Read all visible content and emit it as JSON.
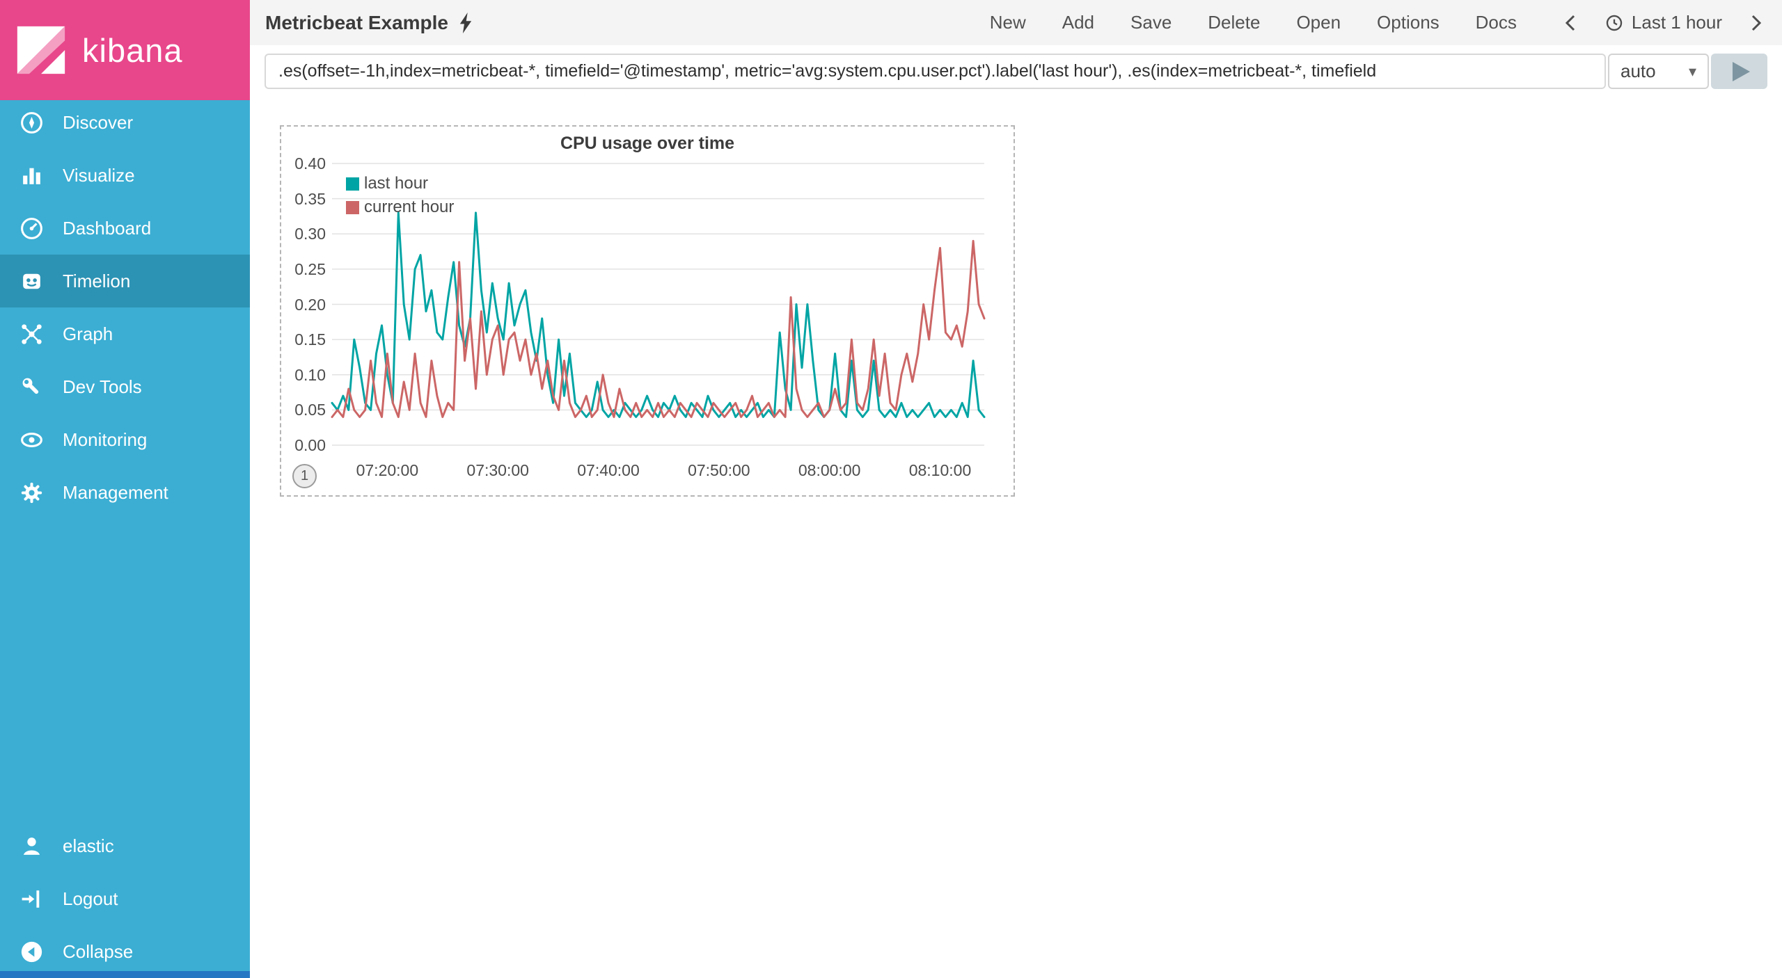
{
  "sidebar": {
    "logo_text": "kibana",
    "items": [
      {
        "label": "Discover",
        "icon": "compass-icon"
      },
      {
        "label": "Visualize",
        "icon": "bar-chart-icon"
      },
      {
        "label": "Dashboard",
        "icon": "gauge-icon"
      },
      {
        "label": "Timelion",
        "icon": "timelion-icon"
      },
      {
        "label": "Graph",
        "icon": "graph-icon"
      },
      {
        "label": "Dev Tools",
        "icon": "wrench-icon"
      },
      {
        "label": "Monitoring",
        "icon": "eye-icon"
      },
      {
        "label": "Management",
        "icon": "gear-icon"
      }
    ],
    "active_item": "Timelion",
    "footer_items": [
      {
        "label": "elastic",
        "icon": "user-icon"
      },
      {
        "label": "Logout",
        "icon": "logout-icon"
      },
      {
        "label": "Collapse",
        "icon": "collapse-icon"
      }
    ],
    "colors": {
      "bg": "#3caed3",
      "active_bg": "#2d93b4",
      "logo_bg": "#e8478b",
      "bottom_accent": "#2577c4"
    }
  },
  "topbar": {
    "title": "Metricbeat Example",
    "title_icon": "bolt-icon",
    "menu_items": [
      "New",
      "Add",
      "Save",
      "Delete",
      "Open",
      "Options",
      "Docs"
    ],
    "time_picker": {
      "label": "Last 1 hour",
      "icon": "clock-icon",
      "prev_icon": "chevron-left-icon",
      "next_icon": "chevron-right-icon"
    }
  },
  "querybar": {
    "query": ".es(offset=-1h,index=metricbeat-*, timefield='@timestamp', metric='avg:system.cpu.user.pct').label('last hour'), .es(index=metricbeat-*, timefield",
    "interval": "auto",
    "caret_icon": "caret-down-icon",
    "run_icon": "play-icon"
  },
  "panel_badge": "1",
  "chart_data": {
    "type": "line",
    "title": "CPU usage over time",
    "xlabel": "",
    "ylabel": "",
    "ylim": [
      0,
      0.4
    ],
    "grid": "horizontal",
    "legend_position": "top-left-inside",
    "y_ticks": [
      0,
      0.05,
      0.1,
      0.15,
      0.2,
      0.25,
      0.3,
      0.35,
      0.4
    ],
    "y_tick_labels": [
      "0.00",
      "0.05",
      "0.10",
      "0.15",
      "0.20",
      "0.25",
      "0.30",
      "0.35",
      "0.40"
    ],
    "x_ticks": [
      "07:20:00",
      "07:30:00",
      "07:40:00",
      "07:50:00",
      "08:00:00",
      "08:10:00"
    ],
    "x_tick_fracs": [
      0.0847,
      0.2542,
      0.4237,
      0.5932,
      0.7627,
      0.9322
    ],
    "x_start": "07:15:00",
    "x_interval_seconds": 30,
    "series": [
      {
        "name": "last hour",
        "color": "#01a4a4",
        "values": [
          0.06,
          0.05,
          0.07,
          0.05,
          0.15,
          0.11,
          0.06,
          0.05,
          0.13,
          0.17,
          0.1,
          0.06,
          0.33,
          0.2,
          0.15,
          0.25,
          0.27,
          0.19,
          0.22,
          0.16,
          0.15,
          0.21,
          0.26,
          0.17,
          0.14,
          0.18,
          0.33,
          0.22,
          0.16,
          0.23,
          0.18,
          0.15,
          0.23,
          0.17,
          0.2,
          0.22,
          0.16,
          0.12,
          0.18,
          0.1,
          0.06,
          0.15,
          0.07,
          0.13,
          0.06,
          0.05,
          0.04,
          0.05,
          0.09,
          0.05,
          0.04,
          0.05,
          0.04,
          0.06,
          0.05,
          0.04,
          0.05,
          0.07,
          0.05,
          0.04,
          0.06,
          0.05,
          0.07,
          0.05,
          0.04,
          0.06,
          0.05,
          0.04,
          0.07,
          0.05,
          0.04,
          0.05,
          0.06,
          0.04,
          0.05,
          0.04,
          0.05,
          0.06,
          0.04,
          0.05,
          0.04,
          0.16,
          0.08,
          0.05,
          0.2,
          0.11,
          0.2,
          0.12,
          0.05,
          0.04,
          0.05,
          0.13,
          0.05,
          0.04,
          0.12,
          0.05,
          0.04,
          0.05,
          0.12,
          0.05,
          0.04,
          0.05,
          0.04,
          0.06,
          0.04,
          0.05,
          0.04,
          0.05,
          0.06,
          0.04,
          0.05,
          0.04,
          0.05,
          0.04,
          0.06,
          0.04,
          0.12,
          0.05,
          0.04
        ]
      },
      {
        "name": "current hour",
        "color": "#cc6666",
        "values": [
          0.04,
          0.05,
          0.04,
          0.08,
          0.05,
          0.04,
          0.05,
          0.12,
          0.06,
          0.04,
          0.13,
          0.06,
          0.04,
          0.09,
          0.05,
          0.13,
          0.06,
          0.04,
          0.12,
          0.07,
          0.04,
          0.06,
          0.05,
          0.26,
          0.12,
          0.18,
          0.08,
          0.19,
          0.1,
          0.15,
          0.17,
          0.1,
          0.15,
          0.16,
          0.12,
          0.15,
          0.1,
          0.13,
          0.08,
          0.12,
          0.07,
          0.05,
          0.12,
          0.06,
          0.04,
          0.05,
          0.07,
          0.04,
          0.05,
          0.1,
          0.06,
          0.04,
          0.08,
          0.05,
          0.04,
          0.06,
          0.04,
          0.05,
          0.04,
          0.06,
          0.04,
          0.05,
          0.04,
          0.06,
          0.05,
          0.04,
          0.06,
          0.05,
          0.04,
          0.06,
          0.05,
          0.04,
          0.05,
          0.06,
          0.04,
          0.05,
          0.07,
          0.04,
          0.05,
          0.06,
          0.04,
          0.05,
          0.04,
          0.21,
          0.08,
          0.05,
          0.04,
          0.05,
          0.06,
          0.04,
          0.05,
          0.08,
          0.05,
          0.06,
          0.15,
          0.06,
          0.05,
          0.08,
          0.15,
          0.07,
          0.13,
          0.06,
          0.05,
          0.1,
          0.13,
          0.09,
          0.13,
          0.2,
          0.15,
          0.22,
          0.28,
          0.16,
          0.15,
          0.17,
          0.14,
          0.19,
          0.29,
          0.2,
          0.18
        ]
      }
    ]
  }
}
